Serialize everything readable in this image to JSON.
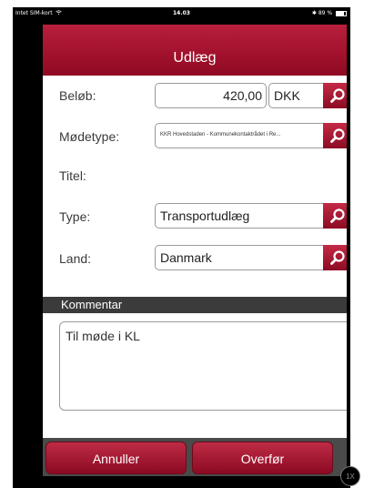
{
  "status_bar": {
    "carrier": "Intet SIM-kort",
    "wifi_icon": "wifi-icon",
    "time": "14.03",
    "bluetooth": "✱",
    "battery_text": "89 %",
    "battery_icon": "battery-icon"
  },
  "header": {
    "title": "Udlæg"
  },
  "form": {
    "amount": {
      "label": "Beløb:",
      "value": "420,00",
      "currency": "DKK"
    },
    "meeting_type": {
      "label": "Mødetype:",
      "value": "KKR Hovedstaden - Kommunekontaktrådet i Re..."
    },
    "title": {
      "label": "Titel:"
    },
    "type": {
      "label": "Type:",
      "value": "Transportudlæg"
    },
    "country": {
      "label": "Land:",
      "value": "Danmark"
    }
  },
  "comment": {
    "section_label": "Kommentar",
    "value": "Til møde i KL"
  },
  "footer": {
    "cancel_label": "Annuller",
    "transfer_label": "Overfør"
  },
  "scale_badge": "1X",
  "colors": {
    "accent": "#a1112c",
    "section_bar": "#3b3b3b",
    "footer_bar": "#4a4a4a"
  },
  "icons": [
    "search-icon",
    "wifi-icon",
    "battery-icon"
  ]
}
